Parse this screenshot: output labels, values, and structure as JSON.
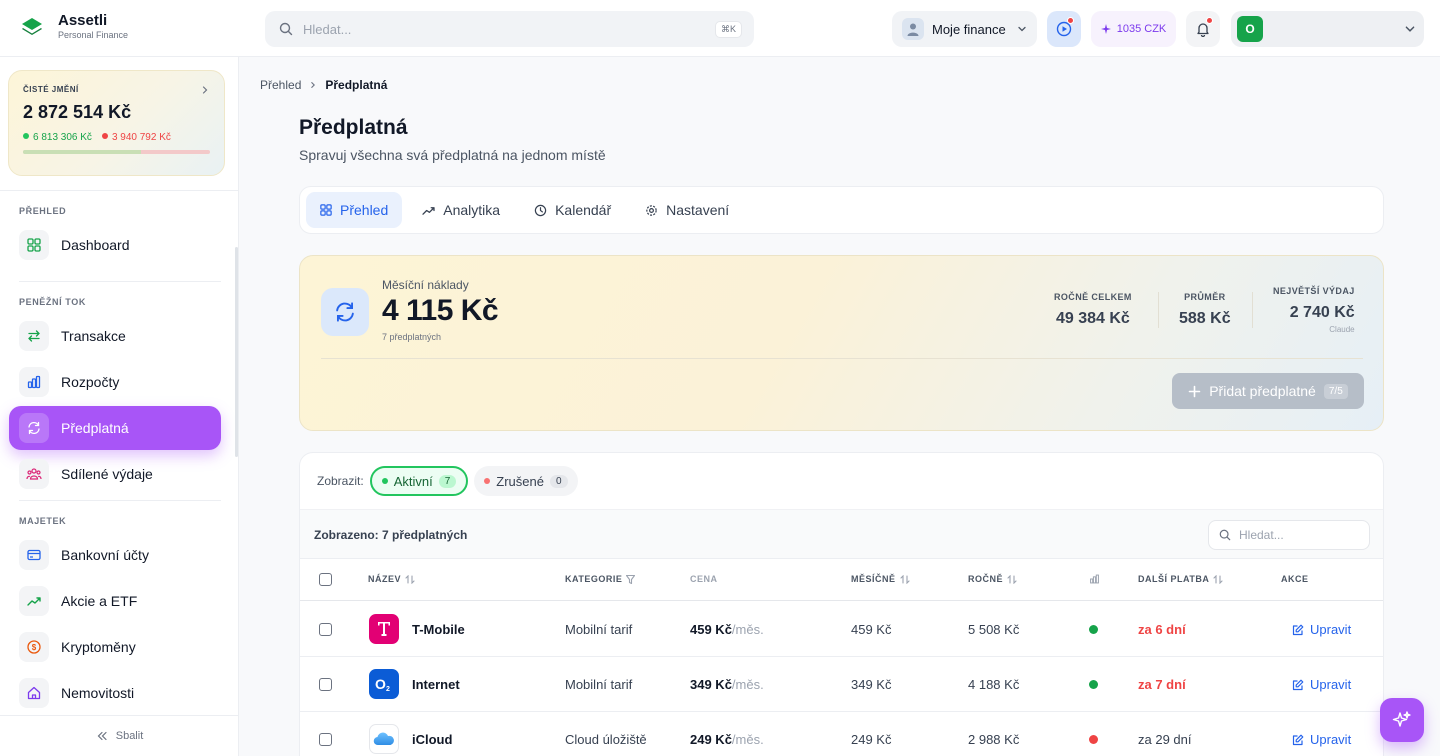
{
  "app": {
    "name": "Assetli",
    "tagline": "Personal Finance"
  },
  "topbar": {
    "search_placeholder": "Hledat...",
    "search_shortcut": "⌘K",
    "finance_label": "Moje finance",
    "credits": "1035 CZK",
    "user_initial": "O"
  },
  "sidebar": {
    "net_worth": {
      "label": "ČISTÉ JMĚNÍ",
      "value": "2 872 514 Kč",
      "assets": "6 813 306 Kč",
      "liabilities": "3 940 792 Kč",
      "assets_fraction": 0.63
    },
    "sections": [
      {
        "title": "PŘEHLED",
        "items": [
          {
            "label": "Dashboard",
            "icon": "grid-icon"
          }
        ]
      },
      {
        "title": "PENĚŽNÍ TOK",
        "items": [
          {
            "label": "Transakce",
            "icon": "arrows-icon"
          },
          {
            "label": "Rozpočty",
            "icon": "bar-chart-icon"
          },
          {
            "label": "Předplatná",
            "icon": "refresh-icon",
            "active": true
          },
          {
            "label": "Sdílené výdaje",
            "icon": "people-icon"
          }
        ]
      },
      {
        "title": "MAJETEK",
        "items": [
          {
            "label": "Bankovní účty",
            "icon": "card-icon"
          },
          {
            "label": "Akcie a ETF",
            "icon": "trend-icon"
          },
          {
            "label": "Kryptoměny",
            "icon": "coin-icon"
          },
          {
            "label": "Nemovitosti",
            "icon": "house-icon"
          }
        ]
      }
    ],
    "collapse_label": "Sbalit"
  },
  "breadcrumb": {
    "parent": "Přehled",
    "current": "Předplatná"
  },
  "page": {
    "title": "Předplatná",
    "subtitle": "Spravuj všechna svá předplatná na jednom místě"
  },
  "tabs": [
    {
      "label": "Přehled",
      "active": true
    },
    {
      "label": "Analytika"
    },
    {
      "label": "Kalendář"
    },
    {
      "label": "Nastavení"
    }
  ],
  "summary": {
    "monthly_label": "Měsíční náklady",
    "monthly_value": "4 115 Kč",
    "count_text": "7 předplatných",
    "yearly_label": "ROČNĚ CELKEM",
    "yearly_value": "49 384 Kč",
    "avg_label": "PRŮMĚR",
    "avg_value": "588 Kč",
    "max_label": "NEJVĚTŠÍ VÝDAJ",
    "max_value": "2 740 Kč",
    "max_name": "Claude",
    "add_label": "Přidat předplatné",
    "add_count": "7/5"
  },
  "filter": {
    "label": "Zobrazit:",
    "active_label": "Aktivní",
    "active_count": "7",
    "cancelled_label": "Zrušené",
    "cancelled_count": "0"
  },
  "table": {
    "shown_text": "Zobrazeno: 7 předplatných",
    "search_placeholder": "Hledat...",
    "columns": {
      "name": "NÁZEV",
      "category": "KATEGORIE",
      "price": "CENA",
      "monthly": "MĚSÍČNĚ",
      "yearly": "ROČNĚ",
      "next": "DALŠÍ PLATBA",
      "actions": "AKCE"
    },
    "price_suffix": "/měs.",
    "edit_label": "Upravit",
    "rows": [
      {
        "name": "T-Mobile",
        "category": "Mobilní tarif",
        "price": "459 Kč",
        "monthly": "459 Kč",
        "yearly": "5 508 Kč",
        "status_color": "#16a34a",
        "next": "za 6 dní",
        "next_urgent": true
      },
      {
        "name": "Internet",
        "category": "Mobilní tarif",
        "price": "349 Kč",
        "monthly": "349 Kč",
        "yearly": "4 188 Kč",
        "status_color": "#16a34a",
        "next": "za 7 dní",
        "next_urgent": true
      },
      {
        "name": "iCloud",
        "category": "Cloud úložiště",
        "price": "249 Kč",
        "monthly": "249 Kč",
        "yearly": "2 988 Kč",
        "status_color": "#ef4444",
        "next": "za 29 dní",
        "next_urgent": false
      }
    ]
  },
  "colors": {
    "accent": "#a855f7",
    "primary": "#2563eb",
    "positive": "#16a34a",
    "negative": "#ef4444"
  }
}
